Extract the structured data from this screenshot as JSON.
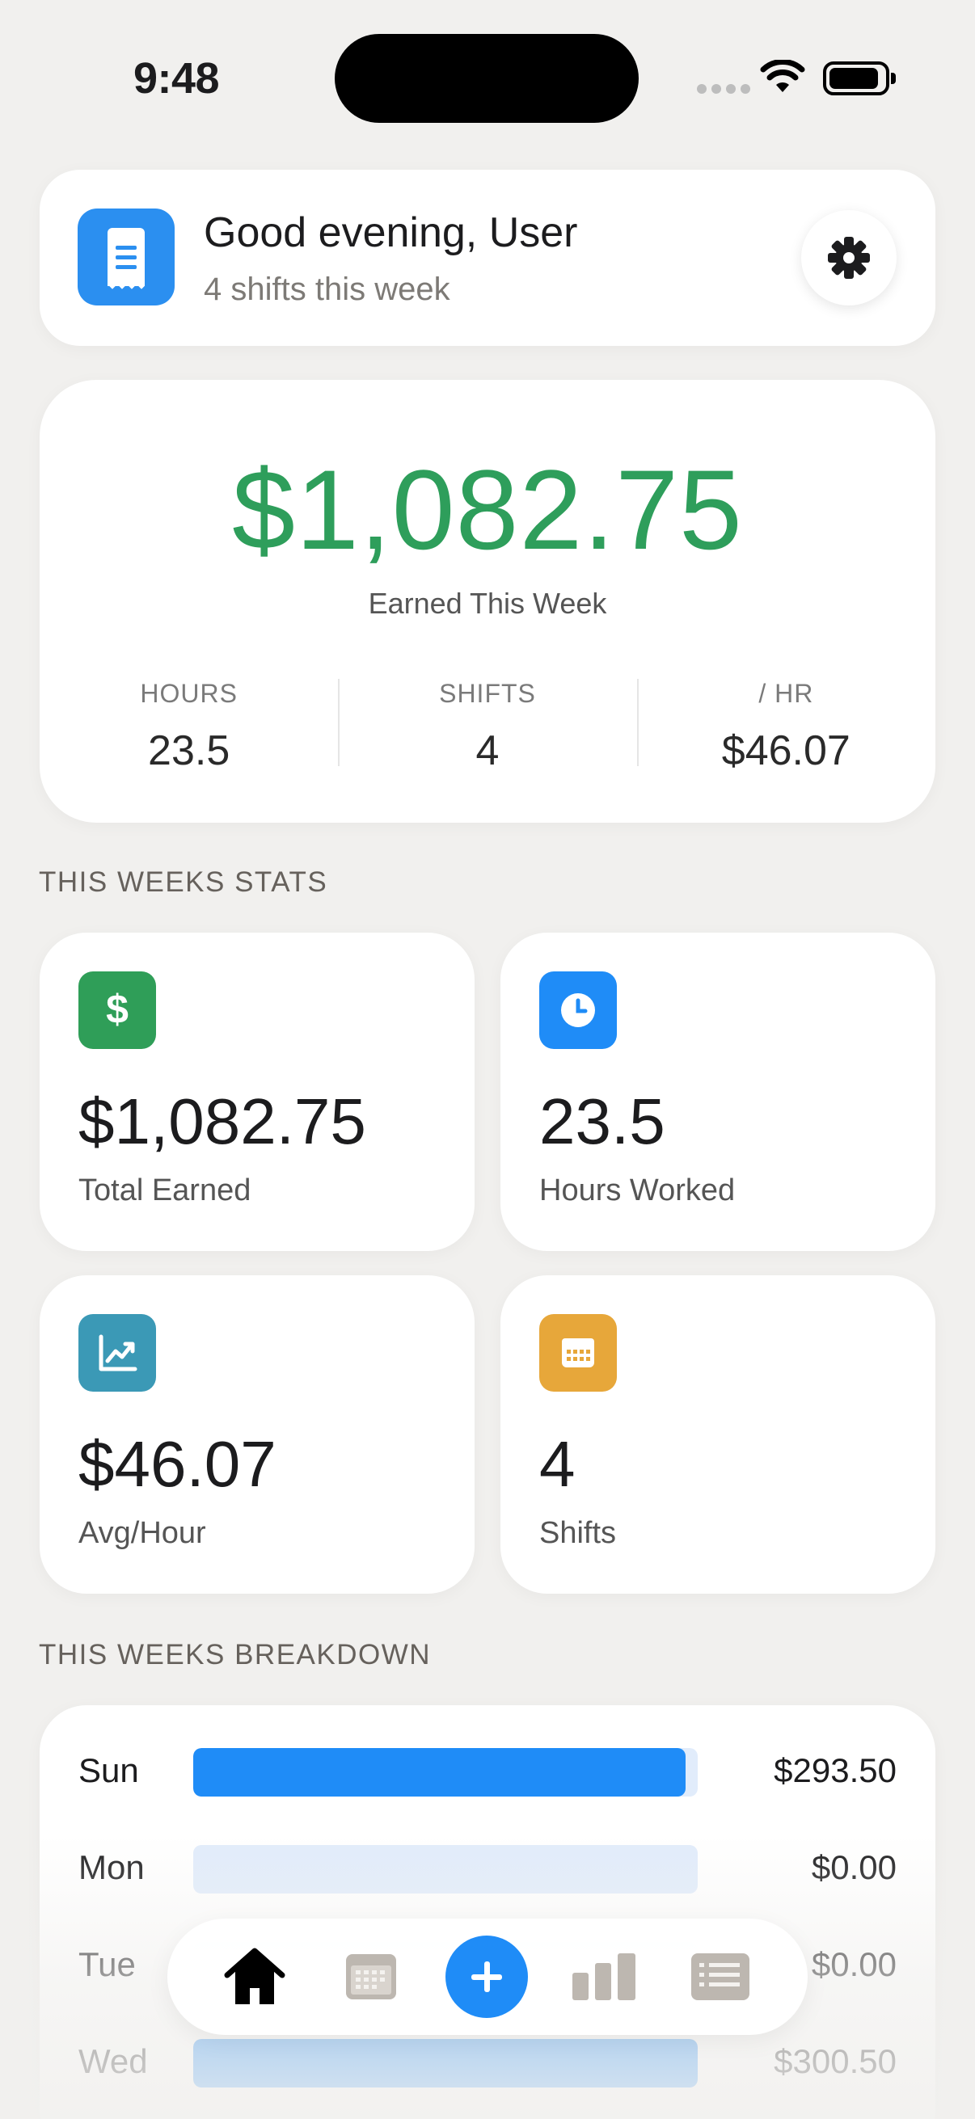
{
  "status_bar": {
    "time": "9:48"
  },
  "header": {
    "greeting": "Good evening, User",
    "subtitle": "4 shifts this week",
    "app_icon": "receipt-icon",
    "settings_icon": "gear-icon"
  },
  "hero": {
    "amount": "$1,082.75",
    "label": "Earned This Week",
    "stats": [
      {
        "label": "HOURS",
        "value": "23.5"
      },
      {
        "label": "SHIFTS",
        "value": "4"
      },
      {
        "label": "/ HR",
        "value": "$46.07"
      }
    ],
    "accent_color": "#2e9e5b"
  },
  "stats_section": {
    "title": "THIS WEEKS STATS",
    "tiles": [
      {
        "value": "$1,082.75",
        "label": "Total Earned",
        "icon": "dollar-icon",
        "color": "#2f9e58"
      },
      {
        "value": "23.5",
        "label": "Hours Worked",
        "icon": "clock-icon",
        "color": "#1f8cf7"
      },
      {
        "value": "$46.07",
        "label": "Avg/Hour",
        "icon": "trend-chart-icon",
        "color": "#3b99b6"
      },
      {
        "value": "4",
        "label": "Shifts",
        "icon": "calendar-icon",
        "color": "#e7a73a"
      }
    ]
  },
  "breakdown": {
    "title": "THIS WEEKS BREAKDOWN",
    "max_value": 300.5,
    "rows": [
      {
        "day": "Sun",
        "amount": "$293.50",
        "value": 293.5
      },
      {
        "day": "Mon",
        "amount": "$0.00",
        "value": 0
      },
      {
        "day": "Tue",
        "amount": "$0.00",
        "value": 0
      },
      {
        "day": "Wed",
        "amount": "$300.50",
        "value": 300.5
      }
    ],
    "bar_color": "#1f8cf7",
    "track_color": "#e1ecfb"
  },
  "tabbar": {
    "tabs": [
      "home-icon",
      "calendar-icon",
      "add-icon",
      "bar-chart-icon",
      "list-icon"
    ],
    "active": "home-icon"
  }
}
